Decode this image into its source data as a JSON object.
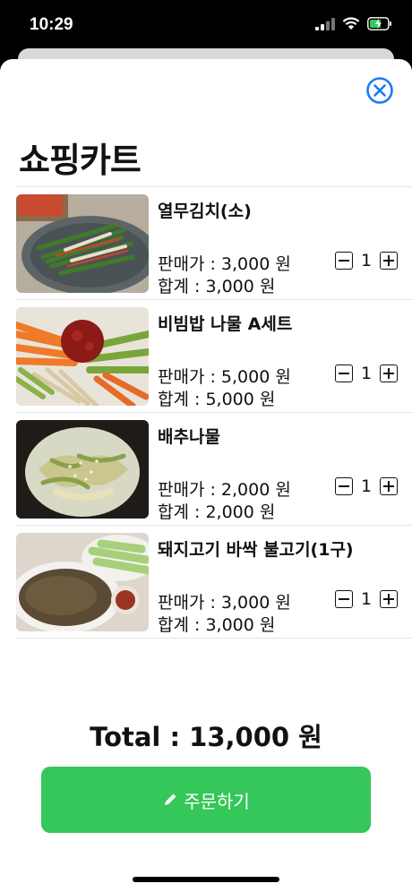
{
  "status_bar": {
    "time": "10:29"
  },
  "page_title": "쇼핑카트",
  "items": [
    {
      "name": "열무김치(소)",
      "price": "판매가 : 3,000 원",
      "total": "합계 : 3,000 원",
      "qty": "1",
      "image": "yeolmu-kimchi"
    },
    {
      "name": "비빔밥 나물 A세트",
      "price": "판매가 : 5,000 원",
      "total": "합계 : 5,000 원",
      "qty": "1",
      "image": "bibimbap-namul"
    },
    {
      "name": "배추나물",
      "price": "판매가 : 2,000 원",
      "total": "합계 : 2,000 원",
      "qty": "1",
      "image": "baechu-namul"
    },
    {
      "name": "돼지고기 바싹 불고기(1구)",
      "price": "판매가 : 3,000 원",
      "total": "합계 : 3,000 원",
      "qty": "1",
      "image": "pork-bulgogi"
    }
  ],
  "total_text": "Total : 13,000 원",
  "order_button": {
    "label": "주문하기",
    "icon": "pencil-icon"
  },
  "colors": {
    "accent_blue": "#1a7cf0",
    "order_green": "#35c759"
  }
}
